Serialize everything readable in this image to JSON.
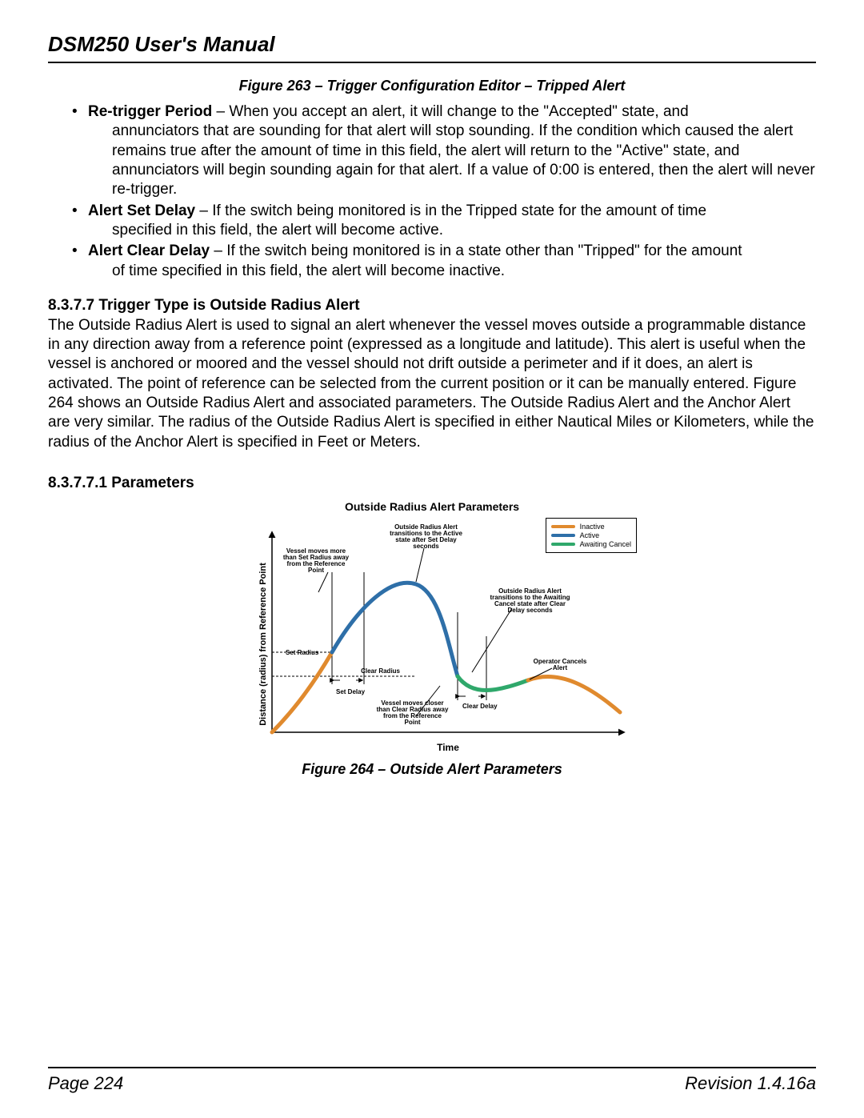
{
  "header": {
    "title": "DSM250 User's Manual"
  },
  "fig263_caption": "Figure 263 – Trigger Configuration Editor – Tripped Alert",
  "defs": [
    {
      "term": "Re-trigger Period",
      "line1": " – When you accept an alert, it will change to the \"Accepted\" state, and",
      "rest": "annunciators that are sounding for that alert will stop sounding. If the condition which caused the alert remains true after the amount of time in this field, the alert will return to the \"Active\" state, and annunciators will begin sounding again for that alert. If a value of 0:00 is entered, then the alert will never re-trigger."
    },
    {
      "term": "Alert Set Delay",
      "line1": " – If the switch being monitored is in the Tripped state for the amount of time",
      "rest": "specified in this field, the alert will become active."
    },
    {
      "term": "Alert Clear Delay",
      "line1": " – If the switch being monitored is in a state other than \"Tripped\" for the amount",
      "rest": "of time specified in this field, the alert will become inactive."
    }
  ],
  "sec_8_3_7_7": {
    "heading": "8.3.7.7  Trigger Type is Outside Radius Alert",
    "body": "The Outside Radius Alert is used to signal an alert whenever the vessel moves outside a programmable distance in any direction away from a reference point (expressed as a longitude and latitude). This alert is useful when the vessel is anchored or moored and the vessel should not drift outside a perimeter and if it does, an alert is activated. The point of reference can be selected from the current position or it can be manually entered. Figure 264 shows an Outside Radius Alert and associated parameters. The Outside Radius Alert and the Anchor Alert are very similar. The radius of the Outside Radius Alert is specified in either Nautical Miles or Kilometers, while the radius of the Anchor Alert is specified in Feet or Meters."
  },
  "sec_8_3_7_7_1_heading": "8.3.7.7.1  Parameters",
  "chart": {
    "title": "Outside Radius Alert Parameters",
    "ylabel": "Distance (radius) from Reference Point",
    "xlabel": "Time",
    "legend": {
      "inactive": "Inactive",
      "active": "Active",
      "await": "Awaiting Cancel"
    },
    "labels": {
      "vessel_set": "Vessel moves more than Set Radius away from the Reference Point",
      "set_radius": "Set Radius",
      "set_delay": "Set Delay",
      "to_active": "Outside Radius Alert transitions to the Active state after Set Delay seconds",
      "clear_radius": "Clear Radius",
      "to_await": "Outside Radius Alert transitions to the Awaiting Cancel state after Clear Delay seconds",
      "vessel_clear": "Vessel moves closer than Clear Radius away from the Reference Point",
      "clear_delay": "Clear Delay",
      "op_cancel": "Operator Cancels Alert"
    }
  },
  "fig264_caption": "Figure 264 – Outside Alert Parameters",
  "footer": {
    "page": "Page 224",
    "rev": "Revision 1.4.16a"
  },
  "chart_data": {
    "type": "line",
    "title": "Outside Radius Alert Parameters",
    "xlabel": "Time",
    "ylabel": "Distance (radius) from Reference Point",
    "series": [
      {
        "name": "Inactive",
        "color": "#e08a2e"
      },
      {
        "name": "Active",
        "color": "#2e6fa8"
      },
      {
        "name": "Awaiting Cancel",
        "color": "#2fa86b"
      }
    ],
    "thresholds": [
      "Set Radius",
      "Clear Radius"
    ],
    "events": [
      "Set Delay",
      "Clear Delay",
      "Operator Cancels Alert"
    ]
  }
}
